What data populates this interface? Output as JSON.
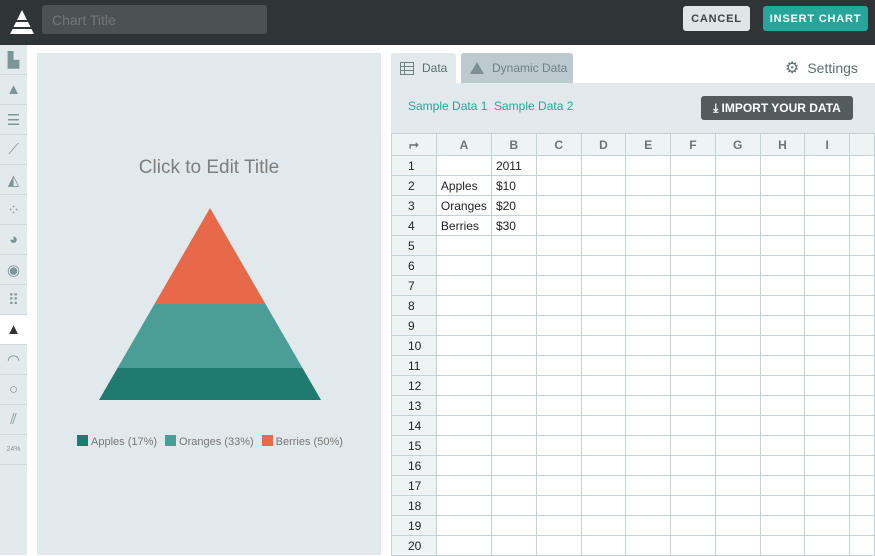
{
  "header": {
    "title_placeholder": "Chart Title",
    "cancel_label": "CANCEL",
    "insert_label": "INSERT CHART"
  },
  "chart_types": [
    "column",
    "stacked-column",
    "bar",
    "line",
    "area",
    "scatter",
    "pie",
    "donut",
    "dot-grid",
    "pyramid",
    "gauge",
    "ring",
    "sparkline",
    "progress"
  ],
  "active_chart_type": "pyramid",
  "progress_icon_text": "24%",
  "chart_data": {
    "type": "pyramid",
    "title": "Click to Edit Title",
    "categories": [
      "Apples",
      "Oranges",
      "Berries"
    ],
    "values": [
      10,
      20,
      30
    ],
    "percents": [
      17,
      33,
      50
    ],
    "legend": [
      "Apples (17%)",
      "Oranges (33%)",
      "Berries (50%)"
    ],
    "colors": [
      "#1f7a6f",
      "#4a9e95",
      "#e8694a"
    ],
    "legend_position": "bottom"
  },
  "tabs": {
    "data": "Data",
    "dynamic": "Dynamic Data",
    "settings": "Settings"
  },
  "toolbar": {
    "sample1": "Sample Data 1",
    "sample2": "Sample Data 2",
    "import": "IMPORT YOUR DATA"
  },
  "sheet": {
    "columns": [
      "A",
      "B",
      "C",
      "D",
      "E",
      "F",
      "G",
      "H",
      "I",
      ""
    ],
    "rows": [
      [
        "",
        "2011"
      ],
      [
        "Apples",
        "$10"
      ],
      [
        "Oranges",
        "$20"
      ],
      [
        "Berries",
        "$30"
      ]
    ],
    "row_count": 20
  }
}
